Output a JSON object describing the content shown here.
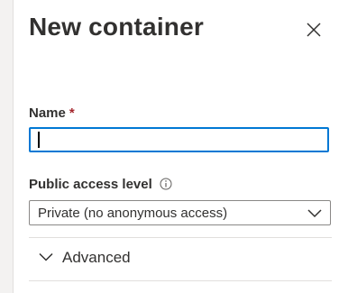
{
  "panel": {
    "title": "New container"
  },
  "icons": {
    "close": "close-icon",
    "info": "info-icon",
    "select_chevron": "chevron-down-icon",
    "advanced_chevron": "chevron-down-icon"
  },
  "form": {
    "name": {
      "label": "Name",
      "required_marker": "*",
      "value": ""
    },
    "public_access_level": {
      "label": "Public access level",
      "selected": "Private (no anonymous access)"
    },
    "advanced": {
      "label": "Advanced"
    }
  },
  "colors": {
    "focus_border": "#0078d4",
    "required": "#a4262c",
    "text": "#323130",
    "divider": "#e1dfdd"
  }
}
